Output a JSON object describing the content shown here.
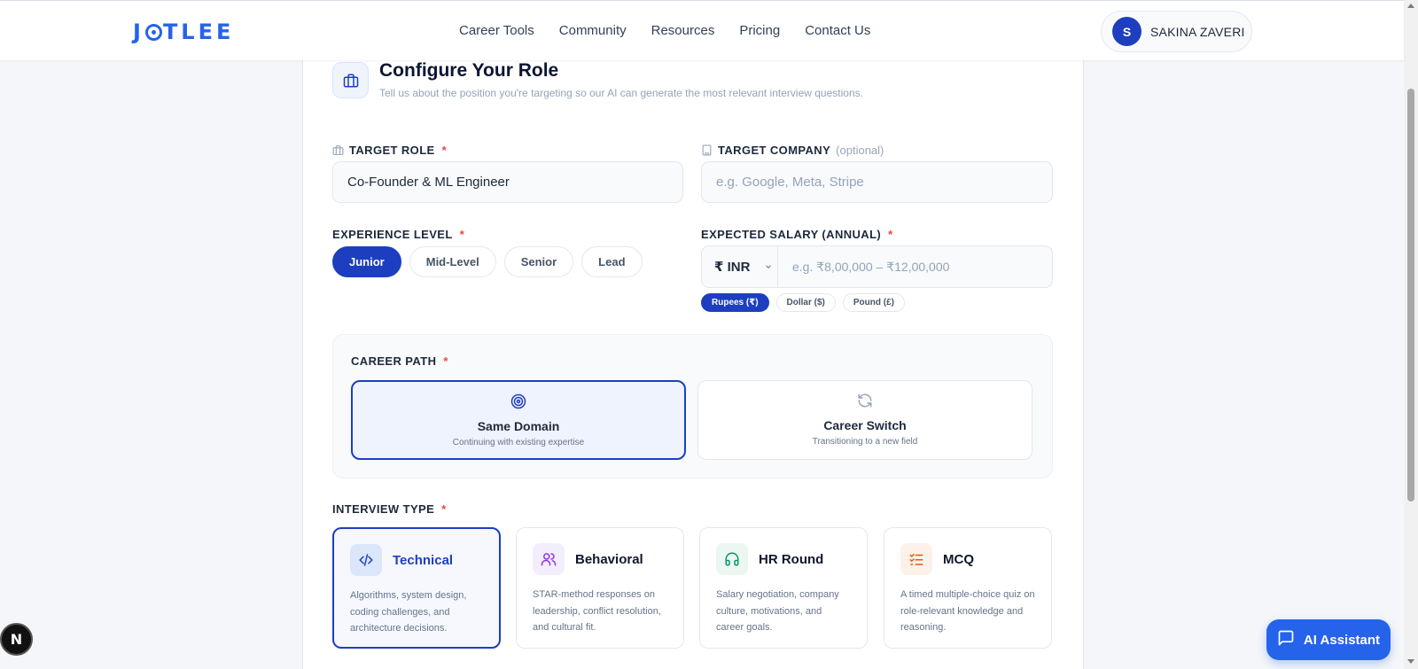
{
  "header": {
    "logo": "JOTLEE",
    "nav": [
      "Career Tools",
      "Community",
      "Resources",
      "Pricing",
      "Contact Us"
    ],
    "user": {
      "initial": "S",
      "name": "SAKINA ZAVERI"
    }
  },
  "page": {
    "title": "Configure Your Role",
    "subtitle": "Tell us about the position you're targeting so our AI can generate the most relevant interview questions."
  },
  "form": {
    "target_role": {
      "label": "TARGET ROLE",
      "required": "*",
      "value": "Co-Founder & ML Engineer"
    },
    "target_company": {
      "label": "TARGET COMPANY",
      "optional": "(optional)",
      "placeholder": "e.g. Google, Meta, Stripe"
    },
    "experience": {
      "label": "EXPERIENCE LEVEL",
      "required": "*",
      "options": [
        "Junior",
        "Mid-Level",
        "Senior",
        "Lead"
      ],
      "selected": "Junior"
    },
    "salary": {
      "label": "EXPECTED SALARY (ANNUAL)",
      "required": "*",
      "currency": "₹ INR",
      "placeholder": "e.g. ₹8,00,000 – ₹12,00,000",
      "currency_options": [
        "Rupees (₹)",
        "Dollar ($)",
        "Pound (£)"
      ],
      "selected_currency": "Rupees (₹)"
    },
    "career_path": {
      "label": "CAREER PATH",
      "required": "*",
      "options": [
        {
          "title": "Same Domain",
          "desc": "Continuing with existing expertise",
          "icon": "target-icon"
        },
        {
          "title": "Career Switch",
          "desc": "Transitioning to a new field",
          "icon": "refresh-icon"
        }
      ],
      "selected": "Same Domain"
    },
    "interview_type": {
      "label": "INTERVIEW TYPE",
      "required": "*",
      "options": [
        {
          "title": "Technical",
          "desc": "Algorithms, system design, coding challenges, and architecture decisions.",
          "icon": "code-icon",
          "color": "#1d3fbf"
        },
        {
          "title": "Behavioral",
          "desc": "STAR-method responses on leadership, conflict resolution, and cultural fit.",
          "icon": "users-icon",
          "color": "#9333ea"
        },
        {
          "title": "HR Round",
          "desc": "Salary negotiation, company culture, motivations, and career goals.",
          "icon": "headphones-icon",
          "color": "#059669"
        },
        {
          "title": "MCQ",
          "desc": "A timed multiple-choice quiz on role-relevant knowledge and reasoning.",
          "icon": "checklist-icon",
          "color": "#ea580c"
        }
      ],
      "selected": "Technical"
    }
  },
  "widgets": {
    "ai_assistant": "AI Assistant",
    "dev_badge": "N"
  },
  "colors": {
    "primary": "#1d3fbf",
    "accent": "#2563eb",
    "required": "#ef4444"
  }
}
